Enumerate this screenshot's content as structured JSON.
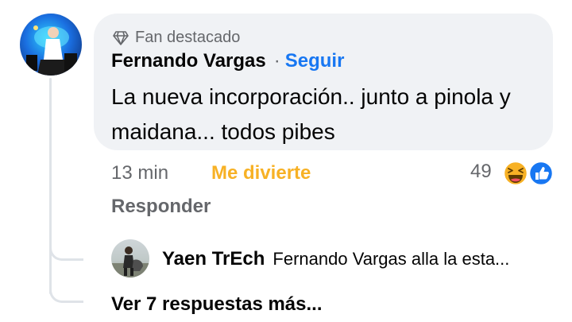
{
  "comment": {
    "badge": "Fan destacado",
    "author": "Fernando Vargas",
    "separator": "·",
    "follow_label": "Seguir",
    "text": "La nueva incorporación.. junto a pinola y maidana... todos pibes",
    "time": "13 min",
    "reaction_label": "Me divierte",
    "reaction_count": "49",
    "reply_label": "Responder",
    "reaction_icons": [
      "haha-icon",
      "like-icon"
    ]
  },
  "reply": {
    "author": "Yaen TrEch",
    "text": "Fernando Vargas alla la esta..."
  },
  "more_replies": "Ver 7 respuestas más...",
  "colors": {
    "bubble": "#f0f2f5",
    "follow": "#1877f2",
    "haha": "#f7b125",
    "secondary_text": "#65676b"
  }
}
